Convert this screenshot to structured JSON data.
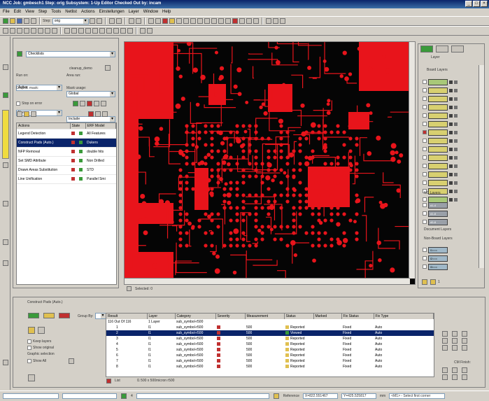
{
  "window": {
    "title": "NCC Job: gmbesch1  Step: orig  Subsystem: 1-Up Editor  Checked Out by: incam"
  },
  "menu": [
    "File",
    "Edit",
    "View",
    "Step",
    "Tools",
    "Netlist",
    "Actions",
    "Einstellungen",
    "Layer",
    "Window",
    "Help"
  ],
  "toolbar": {
    "step_label": "Step:",
    "step_value": "orig"
  },
  "checklist": {
    "combo": "Checklists",
    "name": "cleanup_demo",
    "run_on_label": "Run on:",
    "run_on": "Active",
    "area_run_label": "Area run:",
    "area_run": "Global",
    "graphic_mask_label": "Graphic mask:",
    "graphic_mask": "None",
    "mask_usage_label": "Mask usage:",
    "mask_usage": "Include",
    "stop_on_error": "Stop on error"
  },
  "actions": {
    "headers": [
      "Actions",
      "State",
      "ERF Model"
    ],
    "rows": [
      {
        "name": "Legend Detection",
        "erf": "All Features"
      },
      {
        "name": "Construct Pads (Auto.)",
        "erf": "Dukers"
      },
      {
        "name": "NFP Removal",
        "erf": "double hits"
      },
      {
        "name": "Set SMD Attribute",
        "erf": "Non Drilled"
      },
      {
        "name": "Drawn Areas Substitution",
        "erf": "STD"
      },
      {
        "name": "Line Unification",
        "erf": "Parallel Smi"
      }
    ]
  },
  "canvas": {
    "selected": "Selected: 0"
  },
  "layers": {
    "tab": "Layer",
    "board": "Board Layers",
    "nc": "NC Layers",
    "document": "Document Layers",
    "nonboard": "Non-Board Layers",
    "board_items": [
      "",
      "",
      " ",
      " ",
      " ",
      " ",
      " ",
      " ",
      " ",
      " ",
      " ",
      " ",
      " ",
      " ",
      ""
    ],
    "nc_items": [
      "d1-4",
      "d1-8",
      "d5-8"
    ],
    "nb_items": [
      "l1===",
      "l2===",
      "l3==="
    ],
    "page": "1"
  },
  "bottom": {
    "tab": "Construct Pads (Auto.)",
    "group_by": "Group By:",
    "keep_layers": "Keep layers",
    "show_original": "Show original",
    "graphic_selection": "Graphic selection",
    "show_all": "Show All",
    "headers": [
      "Result",
      "Layer",
      "Category",
      "Severity",
      "Measurement",
      "Status",
      "Marked",
      "Fix Status",
      "Fix Type"
    ],
    "summary": {
      "result": "116 Out Of 116",
      "layer": "1 Layer",
      "category": "sub_symbol-r500"
    },
    "rows": [
      {
        "n": "1",
        "layer": "l1",
        "cat": "sub_symbol-r500",
        "meas": "500",
        "status": "Reported",
        "fix": "Fixed",
        "type": "Auto"
      },
      {
        "n": "2",
        "layer": "l1",
        "cat": "sub_symbol-r500",
        "meas": "500",
        "status": "Viewed",
        "fix": "Fixed",
        "type": "Auto"
      },
      {
        "n": "3",
        "layer": "l1",
        "cat": "sub_symbol-r500",
        "meas": "500",
        "status": "Reported",
        "fix": "Fixed",
        "type": "Auto"
      },
      {
        "n": "4",
        "layer": "l1",
        "cat": "sub_symbol-r500",
        "meas": "500",
        "status": "Reported",
        "fix": "Fixed",
        "type": "Auto"
      },
      {
        "n": "5",
        "layer": "l1",
        "cat": "sub_symbol-r500",
        "meas": "500",
        "status": "Reported",
        "fix": "Fixed",
        "type": "Auto"
      },
      {
        "n": "6",
        "layer": "l1",
        "cat": "sub_symbol-r500",
        "meas": "500",
        "status": "Reported",
        "fix": "Fixed",
        "type": "Auto"
      },
      {
        "n": "7",
        "layer": "l1",
        "cat": "sub_symbol-r500",
        "meas": "500",
        "status": "Reported",
        "fix": "Fixed",
        "type": "Auto"
      },
      {
        "n": "8",
        "layer": "l1",
        "cat": "sub_symbol-r500",
        "meas": "500",
        "status": "Reported",
        "fix": "Fixed",
        "type": "Auto"
      }
    ],
    "list_label": "List",
    "footer_info": "l1  500 x 500micron r500",
    "cm_finish": "CM Finish:"
  },
  "status": {
    "reference": "Reference",
    "x": "X=822.551467",
    "y": "Y=425.525817",
    "unit": "mm",
    "mode": "<M1> - Select first corner",
    "page": "4"
  },
  "colors": {
    "copper": "#e8141b",
    "board": "#050505"
  }
}
